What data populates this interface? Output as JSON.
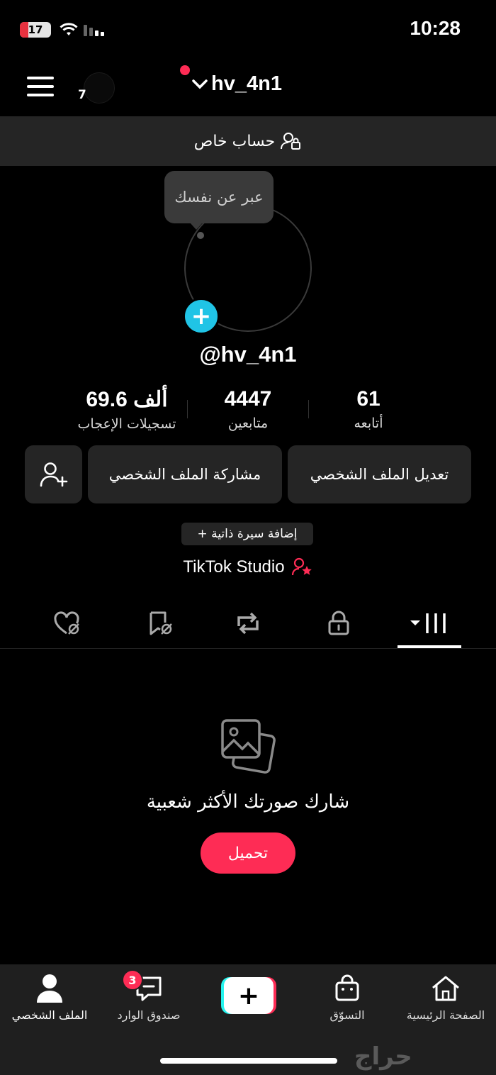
{
  "status": {
    "time": "10:28",
    "battery": "17"
  },
  "header": {
    "story_count": "7",
    "username": "hv_4n1"
  },
  "private_label": "حساب خاص",
  "bio_tooltip": "عبر عن نفسك",
  "handle": "@hv_4n1",
  "stats": {
    "likes_num": "69.6 ألف",
    "likes_label": "تسجيلات الإعجاب",
    "followers_num": "4447",
    "followers_label": "متابعين",
    "following_num": "61",
    "following_label": "أتابعه"
  },
  "buttons": {
    "edit": "تعديل الملف الشخصي",
    "share": "مشاركة الملف الشخصي",
    "add_bio": "+ إضافة سيرة ذاتية"
  },
  "studio": "TikTok Studio",
  "empty": {
    "text": "شارك صورتك الأكثر شعبية",
    "upload": "تحميل"
  },
  "nav": {
    "home": "الصفحة الرئيسية",
    "shop": "التسوّق",
    "inbox": "صندوق الوارد",
    "profile": "الملف الشخصي",
    "inbox_badge": "3"
  },
  "colors": {
    "accent": "#fe2c55",
    "cyan": "#25f4ee",
    "badge_blue": "#20c4e6"
  },
  "watermark": "حراج"
}
